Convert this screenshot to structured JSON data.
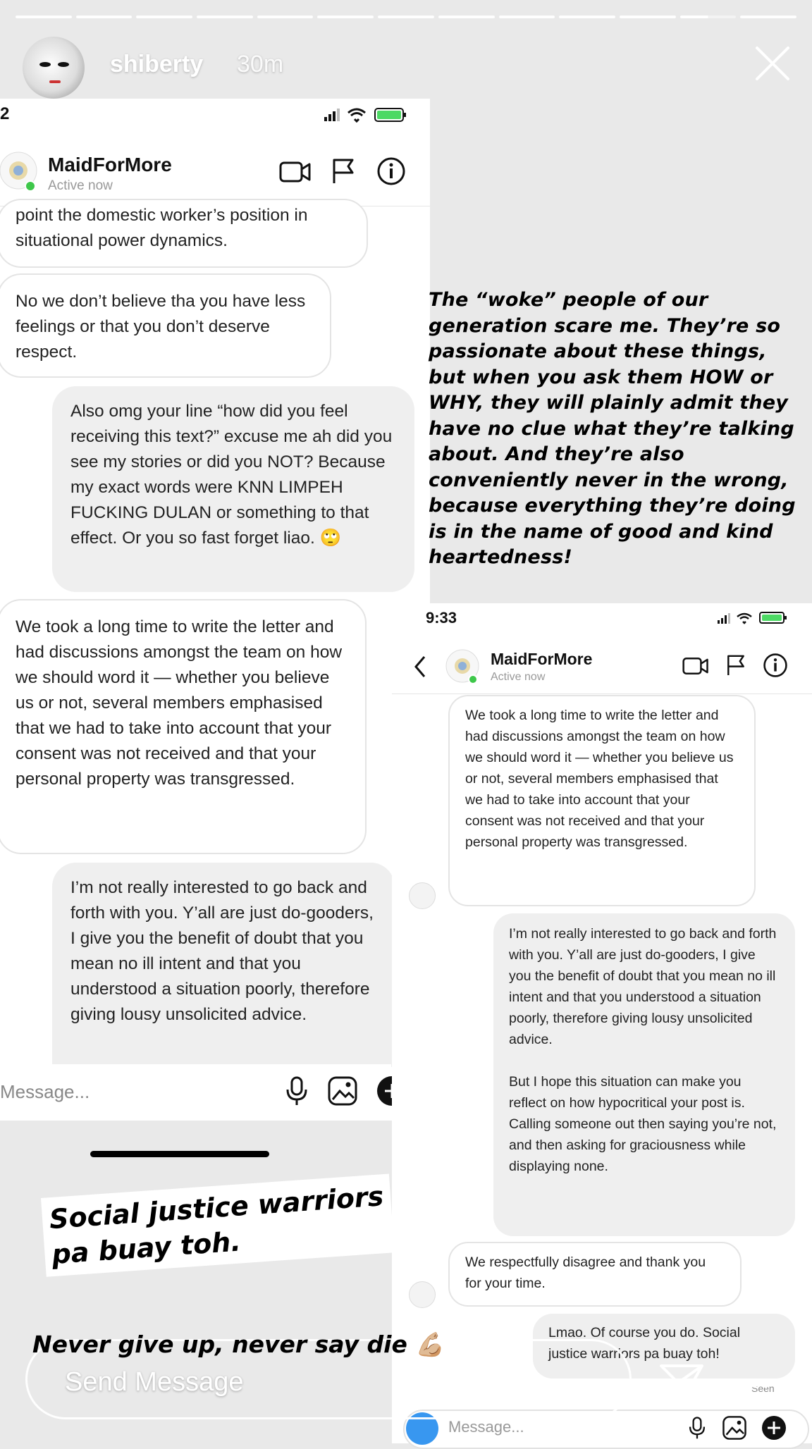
{
  "story": {
    "username": "shiberty",
    "time": "30m",
    "progress_segments": 13,
    "active_segment_index": 11,
    "send_message_placeholder": "Send Message",
    "seen": "Seen"
  },
  "left_screenshot": {
    "status_time": "2",
    "header": {
      "name": "MaidForMore",
      "status": "Active now"
    },
    "messages": [
      {
        "side": "in",
        "text": "point the domestic worker’s position in situational power dynamics."
      },
      {
        "side": "in",
        "text": "No we don’t believe tha you have less feelings or that you don’t deserve respect."
      },
      {
        "side": "out",
        "text": "Also omg your line “how did you feel receiving this text?” excuse me ah did you see my stories or did you NOT? Because my exact words were KNN LIMPEH FUCKING DULAN or something to that effect. Or you so fast forget liao. 🙄"
      },
      {
        "side": "in",
        "text": "We took a long time to write the letter and had discussions amongst the team on how we should word it — whether you believe us or not, several members emphasised that we had to take into account that your consent was not received and that your personal property was transgressed."
      },
      {
        "side": "out",
        "text": "I’m not really interested to go back and forth with you. Y’all are just do-gooders, I give you the benefit of doubt that you mean no ill intent and that you understood a situation poorly, therefore giving lousy unsolicited advice."
      }
    ],
    "message_placeholder": "Message..."
  },
  "right_screenshot": {
    "status_time": "9:33",
    "header": {
      "name": "MaidForMore",
      "status": "Active now"
    },
    "messages": [
      {
        "side": "in",
        "text": "We took a long time to write the letter and had discussions amongst the team on how we should word it — whether you believe us or not, several members emphasised that we had to take into account that your consent was not received and that your personal property was transgressed."
      },
      {
        "side": "out",
        "text": "I’m not really interested to go back and forth with you. Y’all are just do-gooders, I give you the benefit of doubt that you mean no ill intent and that you understood a situation poorly, therefore giving lousy unsolicited advice.\n\nBut I hope this situation can make you reflect on how hypocritical your post is. Calling someone out then saying you’re not, and then asking for graciousness while displaying none."
      },
      {
        "side": "in",
        "text": "We respectfully disagree and thank you for your time."
      },
      {
        "side": "out",
        "text": "Lmao. Of course you do. Social justice warriors pa buay toh!"
      }
    ],
    "message_placeholder": "Message..."
  },
  "captions": {
    "right": "The “woke” people of our generation scare me. They’re so passionate about these things, but when you ask them HOW or WHY, they will plainly admit they have no clue what they’re talking about. And they’re also conveniently never in the wrong, because everything they’re doing is in the name of good and kind heartedness!",
    "bottom_line1": "Social justice warriors",
    "bottom_line2": "pa buay toh.",
    "bottom_line3": "Never give up, never say die 💪🏼"
  },
  "colors": {
    "active_dot": "#3ec74a",
    "battery": "#4cd964",
    "story_text": "#ffffff"
  }
}
